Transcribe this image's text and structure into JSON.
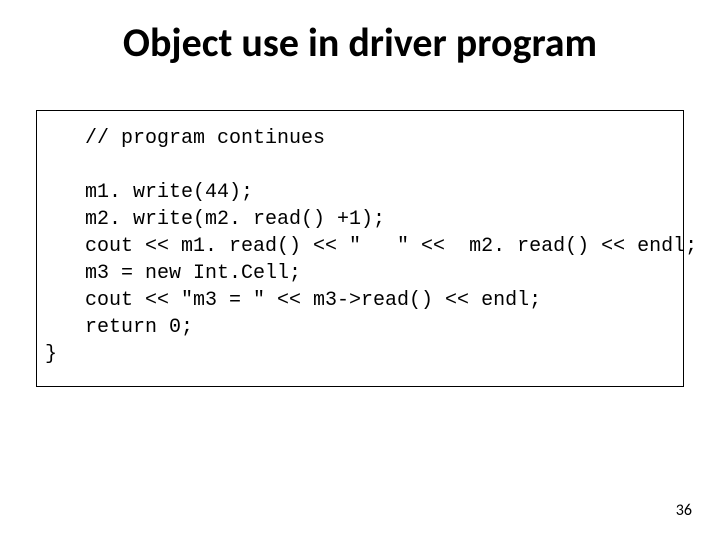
{
  "title": "Object use in driver program",
  "code": {
    "comment": "// program continues",
    "l1": "m1. write(44);",
    "l2": "m2. write(m2. read() +1);",
    "l3": "cout << m1. read() << \"   \" <<  m2. read() << endl;",
    "l4": "m3 = new Int.Cell;",
    "l5": "cout << \"m3 = \" << m3->read() << endl;",
    "l6": "return 0;",
    "close": "}"
  },
  "page_number": "36"
}
